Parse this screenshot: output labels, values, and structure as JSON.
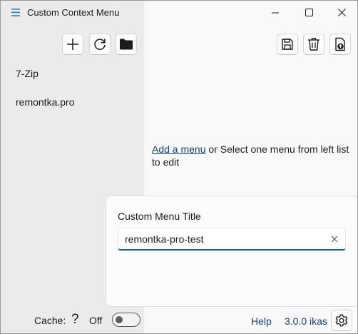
{
  "titlebar": {
    "title": "Custom Context Menu",
    "app_icon": "hamburger-menu-icon",
    "minimize_icon": "minimize-icon",
    "maximize_icon": "maximize-icon",
    "close_icon": "close-icon"
  },
  "sidebar": {
    "toolbar": [
      {
        "icon": "add-icon"
      },
      {
        "icon": "refresh-icon"
      },
      {
        "icon": "folder-icon"
      }
    ],
    "items": [
      {
        "label": "7-Zip"
      },
      {
        "label": "remontka.pro"
      }
    ]
  },
  "main": {
    "toolbar": [
      {
        "icon": "save-icon"
      },
      {
        "icon": "delete-icon"
      },
      {
        "icon": "export-icon"
      }
    ],
    "empty_message": {
      "link_text": "Add a menu",
      "rest_text": " or Select one menu from left list to edit"
    }
  },
  "flyout": {
    "title": "Custom Menu Title",
    "input_value": "remontka-pro-test"
  },
  "footer": {
    "cache_label": "Cache:",
    "help_glyph": "?",
    "toggle_state_label": "Off",
    "toggle_on": false,
    "help_link": "Help",
    "version": "3.0.0 ikas"
  },
  "colors": {
    "accent": "#005fb8",
    "link": "#0b3f91",
    "sidebar_bg": "#ebebeb",
    "content_bg": "#f9f9f9"
  }
}
